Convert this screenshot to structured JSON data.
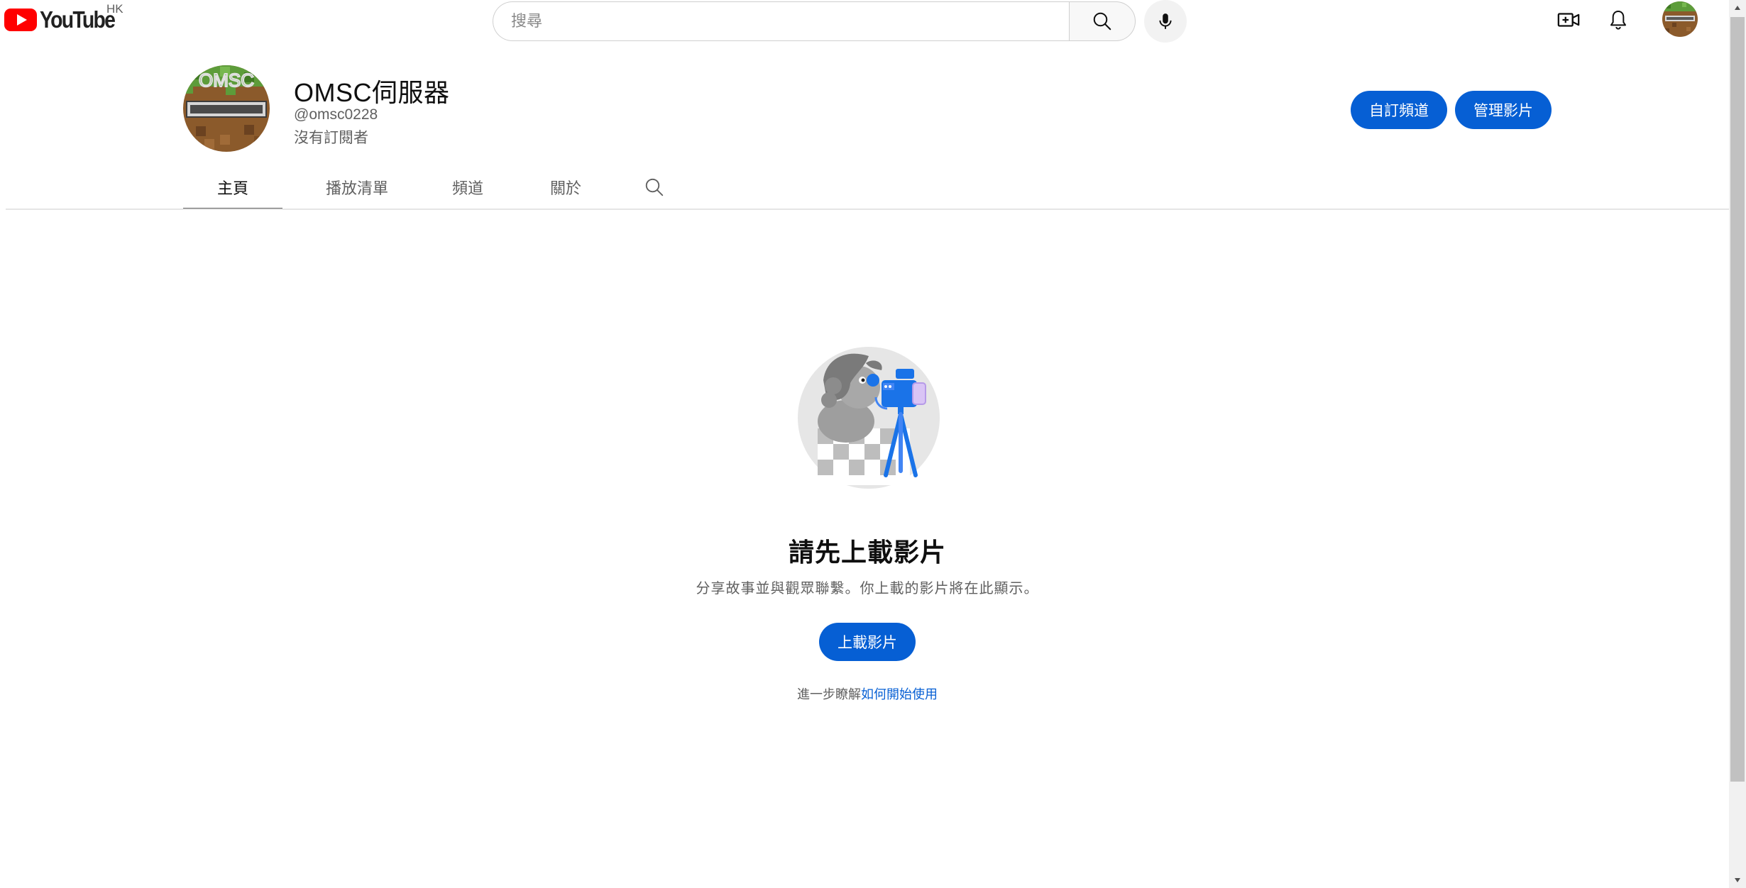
{
  "header": {
    "logo_text": "YouTube",
    "region": "HK",
    "search_placeholder": "搜尋",
    "brand_color": "#ff0000",
    "icons": [
      "search-icon",
      "mic-icon",
      "create-video-icon",
      "bell-icon",
      "avatar"
    ]
  },
  "channel": {
    "name": "OMSC伺服器",
    "handle": "@omsc0228",
    "subscribers": "沒有訂閱者",
    "customize_label": "自訂頻道",
    "manage_label": "管理影片",
    "accent_color": "#065fd4"
  },
  "tabs": [
    {
      "label": "主頁",
      "active": true
    },
    {
      "label": "播放清單",
      "active": false
    },
    {
      "label": "頻道",
      "active": false
    },
    {
      "label": "關於",
      "active": false
    }
  ],
  "empty_state": {
    "title": "請先上載影片",
    "description": "分享故事並與觀眾聯繫。你上載的影片將在此顯示。",
    "upload_label": "上載影片",
    "learn_prefix": "進一步瞭解",
    "learn_link": "如何開始使用"
  }
}
